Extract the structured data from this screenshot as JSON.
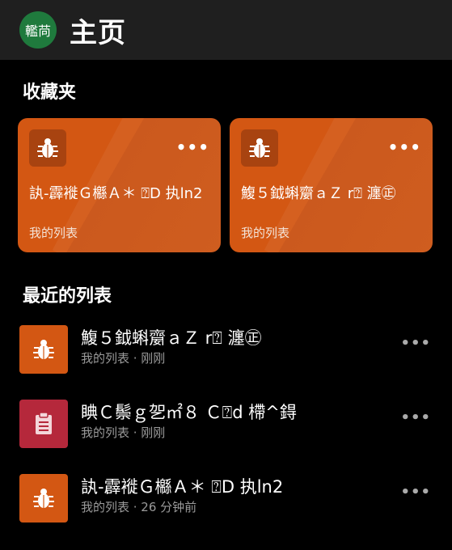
{
  "header": {
    "avatar_text": "轞苘",
    "title": "主页",
    "avatar_color": "#1f7a3d",
    "bar_color": "#1f1f1f"
  },
  "favorites": {
    "title": "收藏夹",
    "accent": "#d35713",
    "cards": [
      {
        "icon": "bug-icon",
        "title": "訙-霹褷Ｇ㰃Ａ＊ ⍰D 执ln2",
        "subtitle": "我的列表",
        "more": "•••"
      },
      {
        "icon": "bug-icon",
        "title": "鰒５鉞蝌䶒ａＺ r⍰ 瀍㊣",
        "subtitle": "我的列表",
        "more": "•••"
      }
    ]
  },
  "recent": {
    "title": "最近的列表",
    "items": [
      {
        "icon": "bug-icon",
        "icon_color": "#d35713",
        "title": "鰒５鉞蝌䶒ａＺ r⍰ 瀍㊣",
        "subtitle": "我的列表 · 刚刚",
        "more": "•••"
      },
      {
        "icon": "clipboard-icon",
        "icon_color": "#b5283b",
        "title": "睓Ｃ鬃ｇ乫㎡８ Ｃ⍰d 㯂^鍀",
        "subtitle": "我的列表 · 刚刚",
        "more": "•••"
      },
      {
        "icon": "bug-icon",
        "icon_color": "#d35713",
        "title": "訙-霹褷Ｇ㰃Ａ＊ ⍰D 执ln2",
        "subtitle": "我的列表 · 26 分钟前",
        "more": "•••"
      }
    ]
  }
}
